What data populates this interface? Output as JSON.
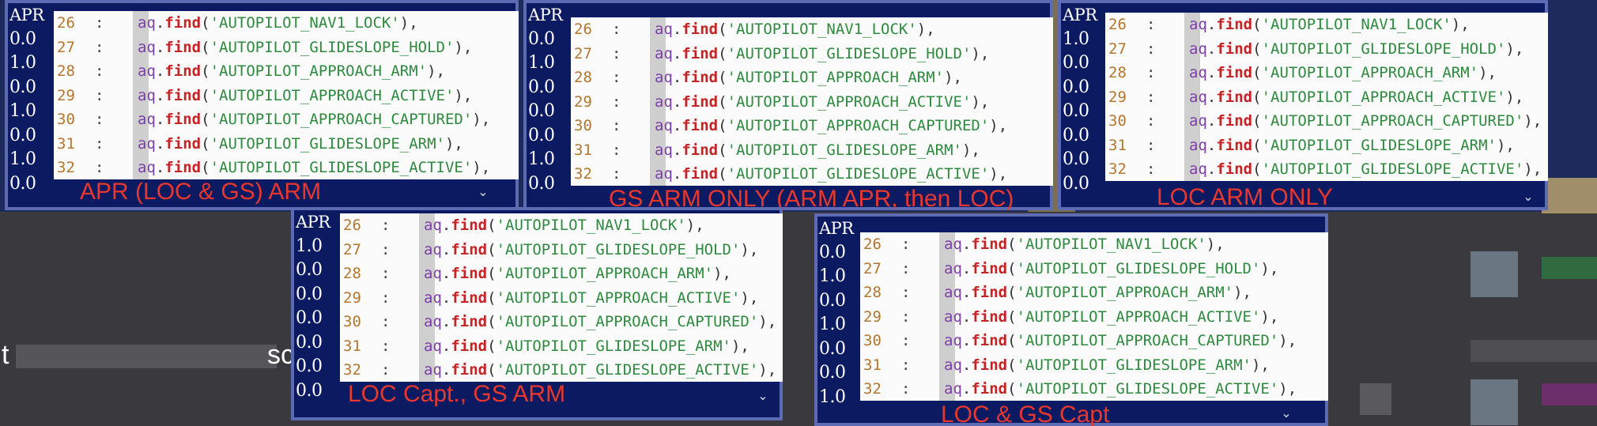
{
  "code_lines": [
    {
      "num": "26",
      "obj": "aq",
      "fn": "find",
      "arg": "'AUTOPILOT_NAV1_LOCK'"
    },
    {
      "num": "27",
      "obj": "aq",
      "fn": "find",
      "arg": "'AUTOPILOT_GLIDESLOPE_HOLD'"
    },
    {
      "num": "28",
      "obj": "aq",
      "fn": "find",
      "arg": "'AUTOPILOT_APPROACH_ARM'"
    },
    {
      "num": "29",
      "obj": "aq",
      "fn": "find",
      "arg": "'AUTOPILOT_APPROACH_ACTIVE'"
    },
    {
      "num": "30",
      "obj": "aq",
      "fn": "find",
      "arg": "'AUTOPILOT_APPROACH_CAPTURED'"
    },
    {
      "num": "31",
      "obj": "aq",
      "fn": "find",
      "arg": "'AUTOPILOT_GLIDESLOPE_ARM'"
    },
    {
      "num": "32",
      "obj": "aq",
      "fn": "find",
      "arg": "'AUTOPILOT_GLIDESLOPE_ACTIVE'"
    }
  ],
  "colon": ":",
  "dot": ".",
  "open_paren": "(",
  "close_paren": "),",
  "apr_header": "APR",
  "panels": [
    {
      "caption": "APR (LOC & GS) ARM",
      "values": [
        "0.0",
        "1.0",
        "0.0",
        "1.0",
        "0.0",
        "1.0",
        "0.0"
      ]
    },
    {
      "caption": "GS ARM ONLY (ARM APR, then LOC)",
      "values": [
        "0.0",
        "1.0",
        "0.0",
        "0.0",
        "0.0",
        "1.0",
        "0.0"
      ]
    },
    {
      "caption": "LOC ARM ONLY",
      "values": [
        "1.0",
        "0.0",
        "0.0",
        "0.0",
        "0.0",
        "0.0",
        "0.0"
      ]
    },
    {
      "caption": "LOC Capt., GS ARM",
      "values": [
        "1.0",
        "0.0",
        "0.0",
        "0.0",
        "0.0",
        "0.0",
        "0.0"
      ]
    },
    {
      "caption": "LOC & GS Capt",
      "values": [
        "0.0",
        "1.0",
        "0.0",
        "1.0",
        "0.0",
        "0.0",
        "1.0"
      ]
    }
  ],
  "chevron_icon": "chevron-down-icon",
  "colors": {
    "panel_bg": "#0c1a62",
    "caption": "#e8382e",
    "code_bg": "#fbfbfb",
    "fn": "#c52424",
    "string": "#2e8a3e",
    "line_number": "#b4762f",
    "object": "#7c3fa8"
  },
  "strip_text_left": "t",
  "strip_text_right": "sc"
}
